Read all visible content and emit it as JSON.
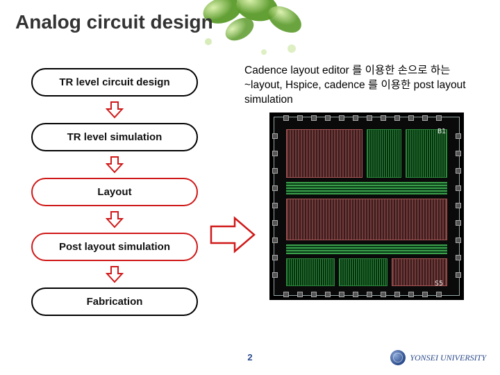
{
  "title": "Analog circuit design",
  "flow": {
    "steps": [
      {
        "label": "TR level circuit design",
        "style": "black"
      },
      {
        "label": "TR level simulation",
        "style": "black"
      },
      {
        "label": "Layout",
        "style": "red"
      },
      {
        "label": "Post layout simulation",
        "style": "red"
      },
      {
        "label": "Fabrication",
        "style": "black"
      }
    ]
  },
  "description": "Cadence layout editor 를 이용한 손으로 하는~layout, Hspice, cadence 를 이용한 post layout simulation",
  "page_number": "2",
  "footer": {
    "university": "YONSEI UNIVERSITY"
  },
  "arrow_colors": {
    "small_down": "#d01818",
    "big_right": "#d01818"
  }
}
